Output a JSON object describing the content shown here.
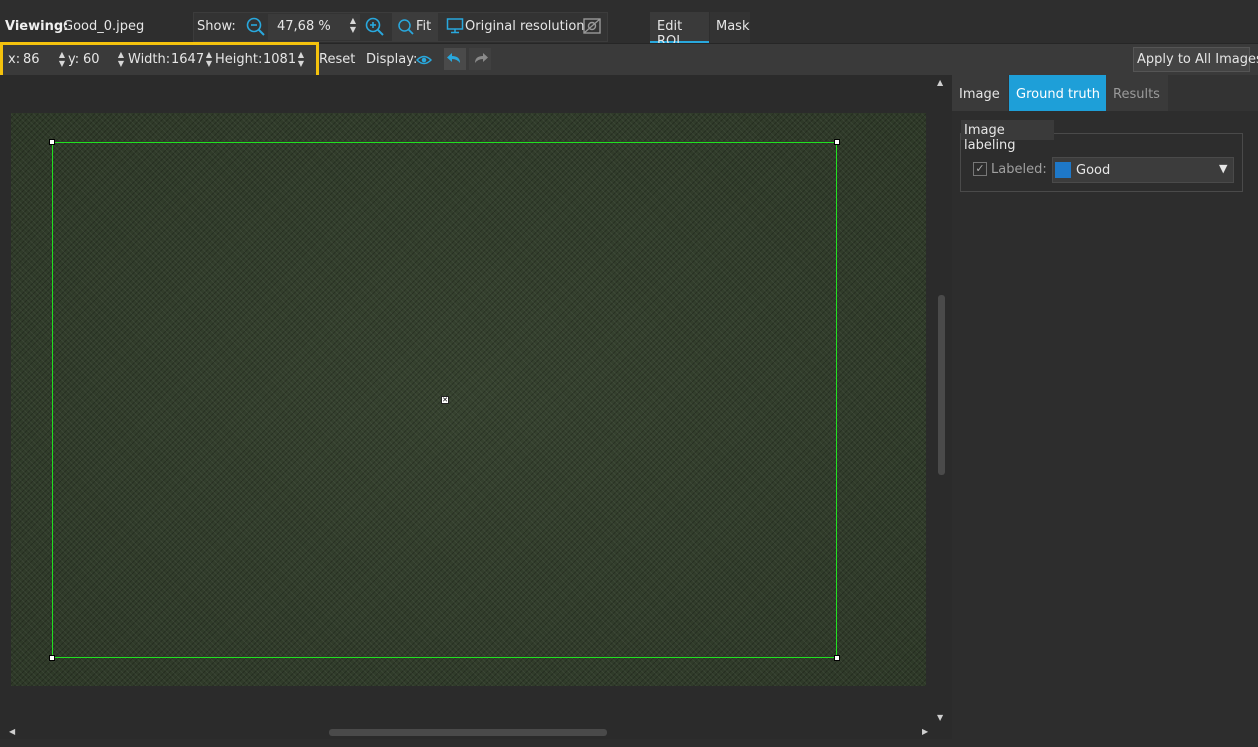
{
  "header": {
    "viewing_label": "Viewing:",
    "filename": "Good_0.jpeg",
    "show_label": "Show:",
    "zoom_value": "47,68 %",
    "fit_label": "Fit",
    "original_resolution_label": "Original resolution",
    "tabs": [
      {
        "label": "Edit ROI",
        "active": true
      },
      {
        "label": "Mask",
        "active": false
      }
    ]
  },
  "roi_toolbar": {
    "x_label": "x:",
    "x_value": "86",
    "y_label": "y:",
    "y_value": "60",
    "width_label": "Width:",
    "width_value": "1647",
    "height_label": "Height:",
    "height_value": "1081",
    "reset_label": "Reset",
    "display_label": "Display:",
    "apply_all_label": "Apply to All Images"
  },
  "right_panel": {
    "tabs": [
      {
        "label": "Image",
        "active": false
      },
      {
        "label": "Ground truth",
        "active": true
      },
      {
        "label": "Results",
        "active": false
      }
    ],
    "group_title": "Image labeling",
    "labeled_label": "Labeled:",
    "labeled_checked": true,
    "label_value": "Good",
    "label_color": "#1e78c8"
  },
  "colors": {
    "accent": "#1e9fd8",
    "highlight": "#f4c20d",
    "roi": "#21e021"
  },
  "icons": [
    "zoom-out-icon",
    "zoom-in-icon",
    "fit-icon",
    "monitor-icon",
    "background-toggle-icon",
    "eye-icon",
    "undo-icon",
    "redo-icon",
    "dropdown-arrow-icon"
  ]
}
